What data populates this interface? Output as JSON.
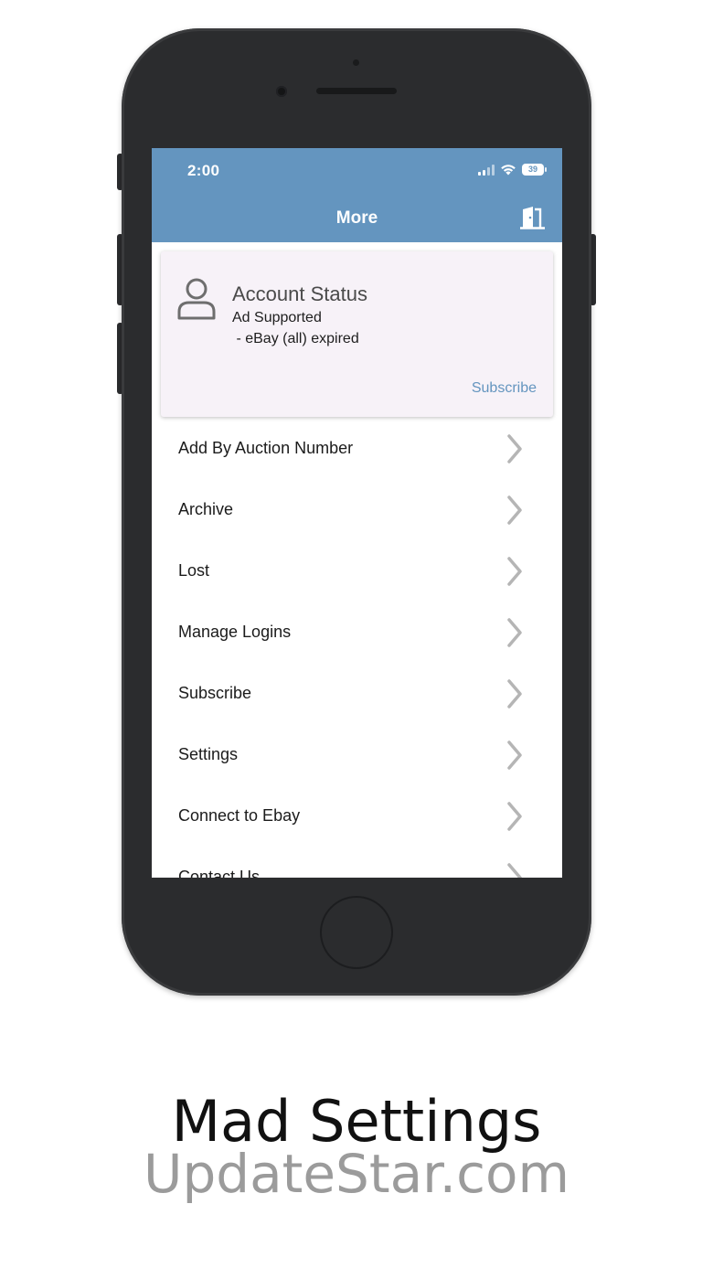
{
  "status_bar": {
    "time": "2:00",
    "battery": "39"
  },
  "nav": {
    "title": "More"
  },
  "account": {
    "title": "Account Status",
    "line1": "Ad Supported",
    "line2": " - eBay (all) expired",
    "subscribe_label": "Subscribe"
  },
  "menu": {
    "items": [
      {
        "label": "Add By Auction Number"
      },
      {
        "label": "Archive"
      },
      {
        "label": "Lost"
      },
      {
        "label": "Manage Logins"
      },
      {
        "label": "Subscribe"
      },
      {
        "label": "Settings"
      },
      {
        "label": "Connect to Ebay"
      },
      {
        "label": "Contact Us"
      }
    ]
  },
  "caption": {
    "title": "Mad Settings",
    "site": "UpdateStar.com"
  },
  "colors": {
    "accent": "#6495bf",
    "card_bg": "#f7f2f8",
    "phone_body": "#2b2c2e"
  },
  "icons": {
    "exit": "exit-door-icon",
    "account": "person-icon",
    "row": "chevron-right-icon"
  }
}
